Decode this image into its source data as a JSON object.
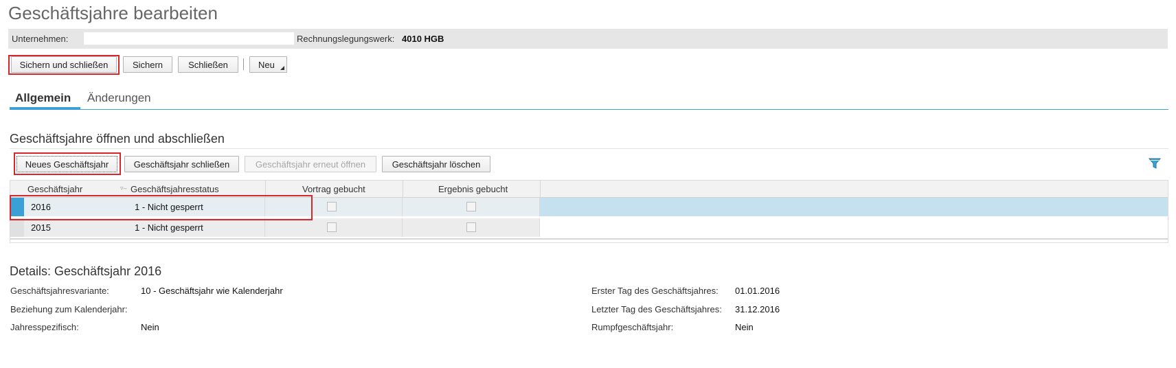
{
  "page": {
    "title": "Geschäftsjahre bearbeiten"
  },
  "infobar": {
    "company_label": "Unternehmen:",
    "company_value": "",
    "ledger_label": "Rechnungslegungswerk:",
    "ledger_value": "4010 HGB"
  },
  "toolbar": {
    "save_close": "Sichern und schließen",
    "save": "Sichern",
    "close": "Schließen",
    "new": "Neu"
  },
  "tabs": [
    {
      "label": "Allgemein",
      "active": true
    },
    {
      "label": "Änderungen",
      "active": false
    }
  ],
  "section": {
    "title": "Geschäftsjahre öffnen und abschließen",
    "buttons": {
      "new_year": "Neues Geschäftsjahr",
      "close_year": "Geschäftsjahr schließen",
      "reopen_year": "Geschäftsjahr erneut öffnen",
      "delete_year": "Geschäftsjahr löschen"
    },
    "filter_icon": "filter-icon"
  },
  "table": {
    "columns": [
      "Geschäftsjahr",
      "Geschäftsjahresstatus",
      "Vortrag gebucht",
      "Ergebnis gebucht"
    ],
    "rows": [
      {
        "year": "2016",
        "status": "1 - Nicht gesperrt",
        "carry_forward": false,
        "result_posted": false,
        "selected": true
      },
      {
        "year": "2015",
        "status": "1 - Nicht gesperrt",
        "carry_forward": false,
        "result_posted": false,
        "selected": false
      }
    ]
  },
  "details": {
    "title": "Details: Geschäftsjahr 2016",
    "left": [
      {
        "label": "Geschäftsjahresvariante:",
        "value": "10 - Geschäftsjahr wie Kalenderjahr"
      },
      {
        "label": "Beziehung zum Kalenderjahr:",
        "value": ""
      },
      {
        "label": "Jahresspezifisch:",
        "value": "Nein"
      }
    ],
    "right": [
      {
        "label": "Erster Tag des Geschäftsjahres:",
        "value": "01.01.2016"
      },
      {
        "label": "Letzter Tag des Geschäftsjahres:",
        "value": "31.12.2016"
      },
      {
        "label": "Rumpfgeschäftsjahr:",
        "value": "Nein"
      }
    ]
  },
  "colors": {
    "accent": "#3aa0d6",
    "highlight": "#d9262e",
    "selected_row": "#c5e1ef"
  }
}
